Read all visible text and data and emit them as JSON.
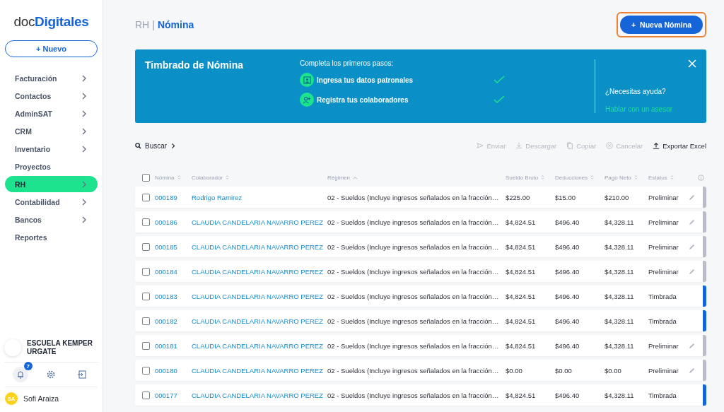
{
  "sidebar": {
    "logo": {
      "light": "doc",
      "bold": "Digitales"
    },
    "new_button": {
      "icon": "+",
      "label": "Nuevo"
    },
    "items": [
      {
        "label": "Facturación",
        "has_children": true,
        "selected": false
      },
      {
        "label": "Contactos",
        "has_children": true,
        "selected": false
      },
      {
        "label": "AdminSAT",
        "has_children": true,
        "selected": false
      },
      {
        "label": "CRM",
        "has_children": true,
        "selected": false
      },
      {
        "label": "Inventario",
        "has_children": true,
        "selected": false
      },
      {
        "label": "Proyectos",
        "has_children": false,
        "selected": false
      },
      {
        "label": "RH",
        "has_children": true,
        "selected": true
      },
      {
        "label": "Contabilidad",
        "has_children": true,
        "selected": false
      },
      {
        "label": "Bancos",
        "has_children": true,
        "selected": false
      },
      {
        "label": "Reportes",
        "has_children": false,
        "selected": false
      }
    ],
    "company": "ESCUELA KEMPER URGATE",
    "notifications": "7",
    "user": {
      "initials": "SA",
      "name": "Sofi Araiza"
    }
  },
  "header": {
    "breadcrumb": "RH",
    "separator": "|",
    "title": "Nómina",
    "action": {
      "icon": "+",
      "label": "Nueva Nómina",
      "highlighted": true
    }
  },
  "banner": {
    "title": "Timbrado de Nómina",
    "intro": "Completa los primeros pasos:",
    "steps": [
      {
        "label": "Ingresa tus datos patronales",
        "kind": "employer",
        "done": true
      },
      {
        "label": "Registra tus colaboradores",
        "kind": "people",
        "done": true
      }
    ],
    "help": "¿Necesitas ayuda?",
    "link": "Hablar con un asesor"
  },
  "toolbar": {
    "search": "Buscar",
    "actions": [
      {
        "label": "Enviar",
        "kind": "send",
        "disabled": true
      },
      {
        "label": "Descargar",
        "kind": "download",
        "disabled": true
      },
      {
        "label": "Copiar",
        "kind": "copy",
        "disabled": true
      },
      {
        "label": "Cancelar",
        "kind": "cancel",
        "disabled": true
      },
      {
        "label": "Exportar Excel",
        "kind": "export",
        "disabled": false
      }
    ]
  },
  "table": {
    "all_checked": false,
    "columns": [
      {
        "label": "Nómina",
        "sorted": false
      },
      {
        "label": "Colaborador",
        "sorted": false
      },
      {
        "label": "Régimen",
        "sorted": true
      },
      {
        "label": "Sueldo Bruto",
        "sorted": false
      },
      {
        "label": "Deducciones",
        "sorted": false
      },
      {
        "label": "Pago Neto",
        "sorted": false
      },
      {
        "label": "Estatus",
        "sorted": false
      }
    ],
    "rows": [
      {
        "checked": false,
        "id": "000189",
        "employee": "Rodrigo Ramirez",
        "regime": "02 - Sueldos (Incluye ingresos señalados en la fracción…",
        "gross": "$225.00",
        "deductions": "$15.00",
        "net": "$210.00",
        "status": "Preliminar",
        "editable": true,
        "color": "#b9bdc7"
      },
      {
        "checked": false,
        "id": "000186",
        "employee": "CLAUDIA CANDELARIA NAVARRO PEREZ",
        "regime": "02 - Sueldos (Incluye ingresos señalados en la fracción…",
        "gross": "$4,824.51",
        "deductions": "$496.40",
        "net": "$4,328.11",
        "status": "Preliminar",
        "editable": true,
        "color": "#b9bdc7"
      },
      {
        "checked": false,
        "id": "000185",
        "employee": "CLAUDIA CANDELARIA NAVARRO PEREZ",
        "regime": "02 - Sueldos (Incluye ingresos señalados en la fracción…",
        "gross": "$4,824.51",
        "deductions": "$496.40",
        "net": "$4,328.11",
        "status": "Preliminar",
        "editable": true,
        "color": "#b9bdc7"
      },
      {
        "checked": false,
        "id": "000184",
        "employee": "CLAUDIA CANDELARIA NAVARRO PEREZ",
        "regime": "02 - Sueldos (Incluye ingresos señalados en la fracción…",
        "gross": "$4,824.51",
        "deductions": "$496.40",
        "net": "$4,328.11",
        "status": "Preliminar",
        "editable": true,
        "color": "#b9bdc7"
      },
      {
        "checked": false,
        "id": "000183",
        "employee": "CLAUDIA CANDELARIA NAVARRO PEREZ",
        "regime": "02 - Sueldos (Incluye ingresos señalados en la fracción…",
        "gross": "$4,824.51",
        "deductions": "$496.40",
        "net": "$4,328.11",
        "status": "Timbrada",
        "editable": false,
        "color": "#1565d8"
      },
      {
        "checked": false,
        "id": "000182",
        "employee": "CLAUDIA CANDELARIA NAVARRO PEREZ",
        "regime": "02 - Sueldos (Incluye ingresos señalados en la fracción…",
        "gross": "$4,824.51",
        "deductions": "$496.40",
        "net": "$4,328.11",
        "status": "Timbrada",
        "editable": false,
        "color": "#1565d8"
      },
      {
        "checked": false,
        "id": "000181",
        "employee": "CLAUDIA CANDELARIA NAVARRO PEREZ",
        "regime": "02 - Sueldos (Incluye ingresos señalados en la fracción…",
        "gross": "$4,824.51",
        "deductions": "$496.40",
        "net": "$4,328.11",
        "status": "Preliminar",
        "editable": true,
        "color": "#b9bdc7"
      },
      {
        "checked": false,
        "id": "000180",
        "employee": "CLAUDIA CANDELARIA NAVARRO PEREZ",
        "regime": "02 - Sueldos (Incluye ingresos señalados en la fracción…",
        "gross": "$0.00",
        "deductions": "$0.00",
        "net": "$0.00",
        "status": "Preliminar",
        "editable": true,
        "color": "#b9bdc7"
      },
      {
        "checked": false,
        "id": "000177",
        "employee": "CLAUDIA CANDELARIA NAVARRO PEREZ",
        "regime": "02 - Sueldos (Incluye ingresos señalados en la fracción…",
        "gross": "$4,824.51",
        "deductions": "$496.40",
        "net": "$4,328.11",
        "status": "Timbrada",
        "editable": false,
        "color": "#1565d8"
      }
    ]
  }
}
